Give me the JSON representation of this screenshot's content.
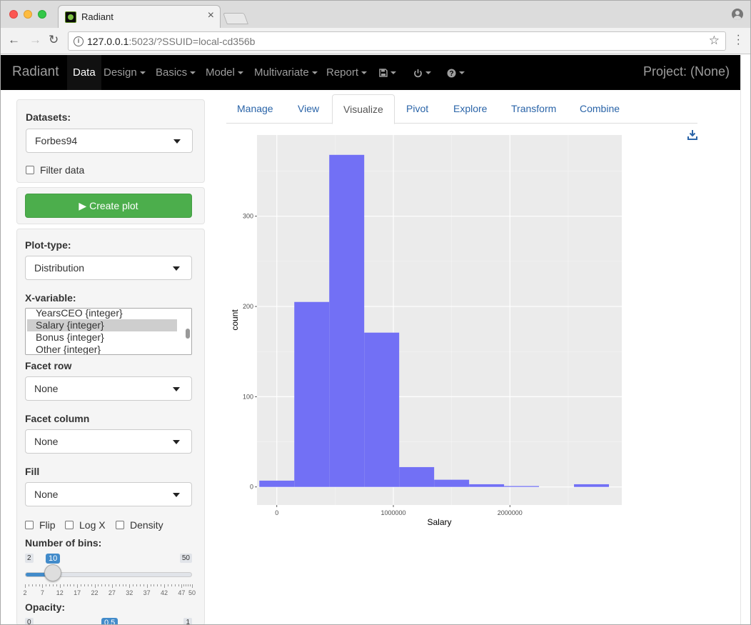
{
  "browser": {
    "tab_title": "Radiant",
    "url_host": "127.0.0.1",
    "url_rest": ":5023/?SSUID=local-cd356b",
    "icons": [
      "back-icon",
      "forward-icon",
      "reload-icon",
      "info-icon",
      "star-icon",
      "menu-icon",
      "profile-icon"
    ]
  },
  "navbar": {
    "brand": "Radiant",
    "items": [
      "Data",
      "Design",
      "Basics",
      "Model",
      "Multivariate",
      "Report"
    ],
    "active": "Data",
    "project": "Project: (None)"
  },
  "sidebar": {
    "datasets_label": "Datasets:",
    "dataset_value": "Forbes94",
    "filter_label": "Filter data",
    "create_plot": "▶ Create plot",
    "plot_type_label": "Plot-type:",
    "plot_type_value": "Distribution",
    "xvar_label": "X-variable:",
    "xvar_options": [
      "YearsCEO {integer}",
      "Salary {integer}",
      "Bonus {integer}",
      "Other {integer}"
    ],
    "xvar_selected": "Salary {integer}",
    "facet_row_label": "Facet row",
    "facet_row_value": "None",
    "facet_col_label": "Facet column",
    "facet_col_value": "None",
    "fill_label": "Fill",
    "fill_value": "None",
    "flip_label": "Flip",
    "logx_label": "Log X",
    "density_label": "Density",
    "bins_label": "Number of bins:",
    "bins_min": "2",
    "bins_max": "50",
    "bins_value": "10",
    "bins_ticks": [
      "2",
      "7",
      "12",
      "17",
      "22",
      "27",
      "32",
      "37",
      "42",
      "47",
      "50"
    ],
    "opacity_label": "Opacity:",
    "opacity_min": "0",
    "opacity_max": "1",
    "opacity_value": "0.5"
  },
  "tabs": [
    "Manage",
    "View",
    "Visualize",
    "Pivot",
    "Explore",
    "Transform",
    "Combine"
  ],
  "active_tab": "Visualize",
  "colors": {
    "bar_fill": "#7270f5",
    "panel_bg": "#ebebeb",
    "accent": "#428bca",
    "create_btn": "#4cae4c"
  },
  "chart_data": {
    "type": "bar",
    "xlabel": "Salary",
    "ylabel": "count",
    "xlim": [
      -170000,
      2960000
    ],
    "ylim": [
      -20,
      390
    ],
    "x_ticks": [
      0,
      1000000,
      2000000
    ],
    "x_tick_labels": [
      "0",
      "1000000",
      "2000000"
    ],
    "y_ticks": [
      0,
      100,
      200,
      300
    ],
    "y_tick_labels": [
      "0",
      "100",
      "200",
      "300"
    ],
    "grid": true,
    "bin_width": 300000,
    "bin_centers": [
      0,
      300000,
      600000,
      900000,
      1200000,
      1500000,
      1800000,
      2100000,
      2400000,
      2700000
    ],
    "values": [
      7,
      205,
      368,
      171,
      22,
      8,
      3,
      1,
      0,
      3
    ]
  }
}
